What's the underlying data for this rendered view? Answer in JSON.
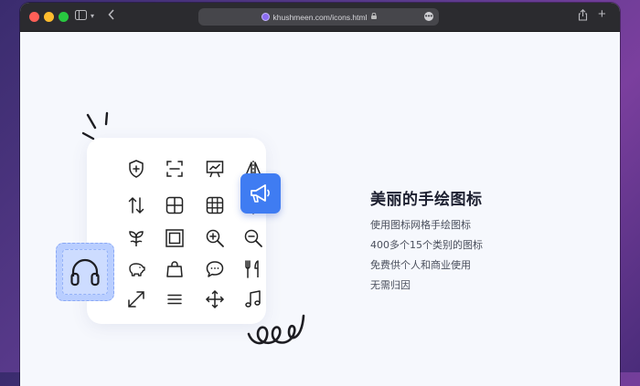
{
  "browser": {
    "url": "khushmeen.com/icons.html"
  },
  "hero": {
    "title": "美丽的手绘图标",
    "lines": [
      "使用图标网格手绘图标",
      "400多个15个类别的图标",
      "免费供个人和商业使用",
      "无需归因"
    ]
  },
  "icon_grid": [
    "shield-plus-icon",
    "scan-icon",
    "chart-board-icon",
    "flip-icon",
    "sort-arrows-icon",
    "grid-2x2-icon",
    "grid-3x3-icon",
    "cloud-upload-icon",
    "plant-icon",
    "frame-icon",
    "zoom-in-icon",
    "zoom-out-icon",
    "piggy-bank-icon",
    "shopping-bag-icon",
    "chat-bubble-icon",
    "cutlery-icon",
    "expand-icon",
    "menu-lines-icon",
    "move-icon",
    "music-note-icon"
  ],
  "colors": {
    "accent_blue": "#3f7cf2",
    "badge_light_blue": "#b9ceff",
    "page_background": "#f6f8fd"
  }
}
